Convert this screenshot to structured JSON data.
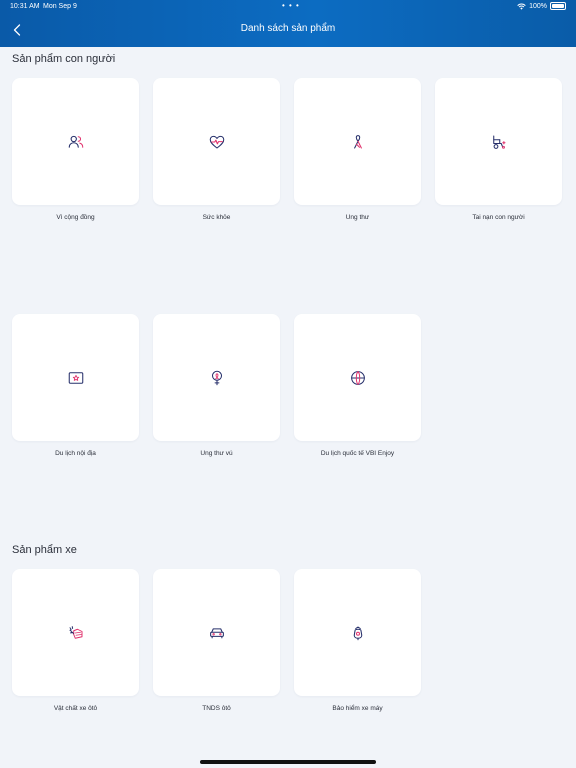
{
  "status": {
    "time": "10:31 AM",
    "date": "Mon Sep 9",
    "dots": "• • •",
    "battery": "100%"
  },
  "header": {
    "title": "Danh sách sản phẩm",
    "back_icon": "chevron-left-icon"
  },
  "sections": [
    {
      "title": "Sản phẩm con người",
      "items": [
        {
          "label": "Vì cộng đồng",
          "icon": "people-icon"
        },
        {
          "label": "Sức khỏe",
          "icon": "heart-pulse-icon"
        },
        {
          "label": "Ung thư",
          "icon": "ribbon-icon"
        },
        {
          "label": "Tai nạn con người",
          "icon": "wheelchair-icon"
        },
        {
          "label": "Du lịch nội địa",
          "icon": "star-card-icon"
        },
        {
          "label": "Ung thư vú",
          "icon": "female-ribbon-icon"
        },
        {
          "label": "Du lịch quốc tế VBI Enjoy",
          "icon": "globe-icon"
        }
      ]
    },
    {
      "title": "Sản phẩm xe",
      "items": [
        {
          "label": "Vật chất xe ôtô",
          "icon": "car-damage-icon"
        },
        {
          "label": "TNDS ôtô",
          "icon": "car-icon"
        },
        {
          "label": "Bảo hiểm xe máy",
          "icon": "scooter-icon"
        }
      ]
    }
  ],
  "colors": {
    "header": "#0c6cc2",
    "icon_primary": "#27306b",
    "icon_accent": "#e0306b",
    "background": "#f1f4f9"
  }
}
